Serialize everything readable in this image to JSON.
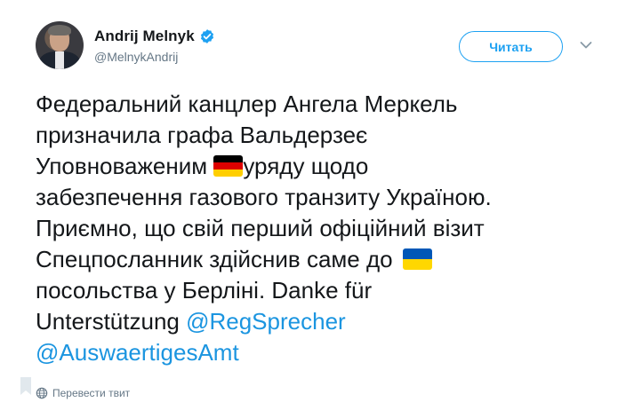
{
  "author": {
    "display_name": "Andrij Melnyk",
    "handle": "@MelnykAndrij",
    "verified": true
  },
  "follow_button": {
    "label": "Читать"
  },
  "tweet": {
    "lines": {
      "l1": "Федеральний канцлер Ангела Меркель",
      "l2": "призначила графа Вальдерзеє",
      "l3_before": "Уповноваженим ",
      "l3_after": "уряду щодо",
      "l4": "забезпечення газового транзиту Україною.",
      "l5": "Приємно, що свій перший офіційний візит",
      "l6": "Спецпосланник здійснив саме до",
      "l7": "посольства у Берліні. Danke für",
      "l8_before": "Unterstützung "
    },
    "mentions": {
      "m1": "@RegSprecher",
      "m2": "@AuswaertigesAmt"
    },
    "flags": [
      "german-flag",
      "ukrainian-flag"
    ]
  },
  "translate": {
    "label": "Перевести твит"
  },
  "colors": {
    "accent": "#1da1f2",
    "mention": "#1b95e0",
    "muted": "#657786",
    "text": "#14171a"
  }
}
